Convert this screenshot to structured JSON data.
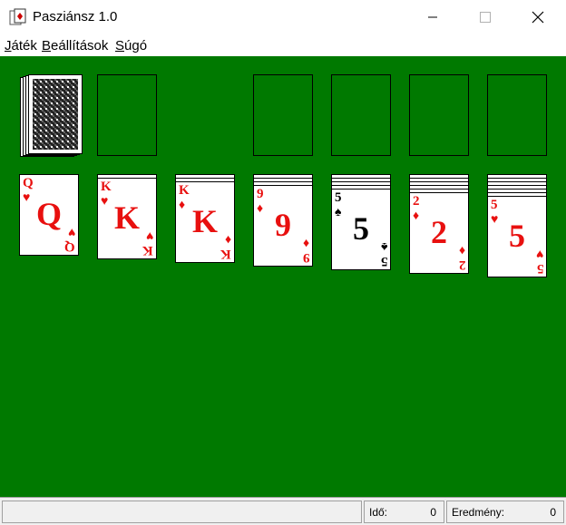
{
  "window": {
    "title": "Pasziánsz 1.0",
    "controls": [
      "minimize-icon",
      "maximize-icon",
      "close-icon"
    ]
  },
  "menu": {
    "items": [
      {
        "mnemonic": "J",
        "rest": "áték"
      },
      {
        "mnemonic": "B",
        "rest": "eállítások"
      },
      {
        "mnemonic": "S",
        "rest": "úgó"
      }
    ]
  },
  "table": {
    "color": "#007900",
    "stock": {
      "face": "down",
      "cards_visible": true
    },
    "waste": {
      "empty": true
    },
    "foundations": [
      {
        "empty": true
      },
      {
        "empty": true
      },
      {
        "empty": true
      },
      {
        "empty": true
      }
    ],
    "tableau": [
      {
        "hidden": 0,
        "top": {
          "rank": "Q",
          "suit": "♥",
          "color": "red"
        }
      },
      {
        "hidden": 1,
        "top": {
          "rank": "K",
          "suit": "♥",
          "color": "red"
        }
      },
      {
        "hidden": 2,
        "top": {
          "rank": "K",
          "suit": "♦",
          "color": "red"
        }
      },
      {
        "hidden": 3,
        "top": {
          "rank": "9",
          "suit": "♦",
          "color": "red"
        }
      },
      {
        "hidden": 4,
        "top": {
          "rank": "5",
          "suit": "♠",
          "color": "black"
        }
      },
      {
        "hidden": 5,
        "top": {
          "rank": "2",
          "suit": "♦",
          "color": "red"
        }
      },
      {
        "hidden": 6,
        "top": {
          "rank": "5",
          "suit": "♥",
          "color": "red"
        }
      }
    ]
  },
  "status": {
    "time_label": "Idő:",
    "time_value": "0",
    "score_label": "Eredmény:",
    "score_value": "0"
  }
}
